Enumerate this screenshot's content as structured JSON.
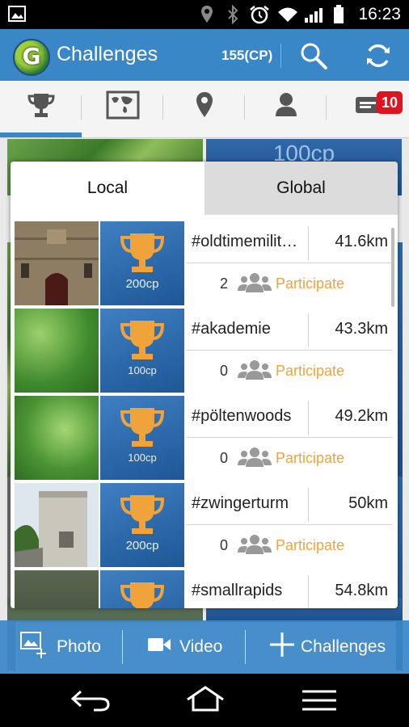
{
  "status_bar": {
    "time": "16:23"
  },
  "app_bar": {
    "title": "Challenges",
    "logo_letter": "G",
    "points": "155(CP)"
  },
  "tabs": [
    {
      "name": "trophy-icon",
      "active": true
    },
    {
      "name": "map-icon"
    },
    {
      "name": "location-pin-icon"
    },
    {
      "name": "profile-icon"
    },
    {
      "name": "messages-icon",
      "badge": "10"
    }
  ],
  "background": {
    "points_label": "100cp"
  },
  "modal": {
    "segments": {
      "local": "Local",
      "global": "Global"
    },
    "challenges": [
      {
        "tag": "#oldtimemilitaer",
        "distance": "41.6km",
        "points": "200cp",
        "participants": "2",
        "action": "Participate",
        "thumb": "building"
      },
      {
        "tag": "#akademie",
        "distance": "43.3km",
        "points": "100cp",
        "participants": "0",
        "action": "Participate",
        "thumb": "forest"
      },
      {
        "tag": "#pöltenwoods",
        "distance": "49.2km",
        "points": "100cp",
        "participants": "0",
        "action": "Participate",
        "thumb": "forest"
      },
      {
        "tag": "#zwingerturm",
        "distance": "50km",
        "points": "200cp",
        "participants": "0",
        "action": "Participate",
        "thumb": "tower"
      },
      {
        "tag": "#smallrapids",
        "distance": "54.8km",
        "points": "",
        "participants": "",
        "action": "",
        "thumb": "rapids"
      }
    ]
  },
  "bottom_bar": {
    "photo": "Photo",
    "video": "Video",
    "challenges": "Challenges"
  },
  "colors": {
    "primary": "#3a87c8",
    "accent": "#f0a33a",
    "badge": "#e0141e"
  }
}
